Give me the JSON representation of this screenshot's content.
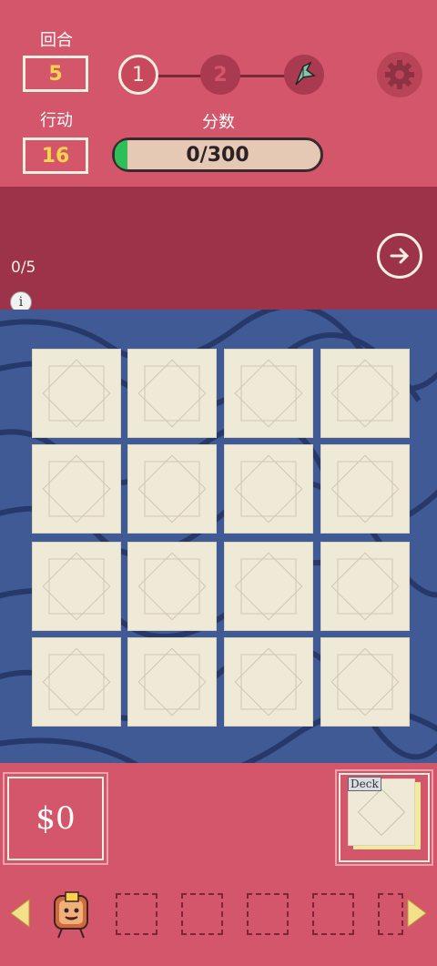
{
  "hud": {
    "round_label": "回合",
    "round_value": "5",
    "actions_label": "行动",
    "actions_value": "16",
    "score_label": "分数",
    "score_text": "0/300",
    "score_progress_fraction": 0.0,
    "stages": [
      "1",
      "2"
    ]
  },
  "info": {
    "hand_count": "0/5",
    "info_glyph": "i"
  },
  "board": {
    "rows": 4,
    "cols": 4,
    "tiles": 16
  },
  "footer": {
    "money": "$0",
    "deck_label": "Deck",
    "inventory_slots": 5
  },
  "icons": {
    "settings": "gear-icon",
    "next": "arrow-right-icon",
    "boss": "origami-bird-icon",
    "left": "triangle-left-icon",
    "right": "triangle-right-icon",
    "character": "toast-character-icon"
  },
  "colors": {
    "primary_bg": "#d4566a",
    "band": "#9c3348",
    "board": "#3f5a94",
    "tile": "#efe9d7",
    "accent_yellow": "#f7d44c",
    "score_fill": "#2fbf5a"
  }
}
